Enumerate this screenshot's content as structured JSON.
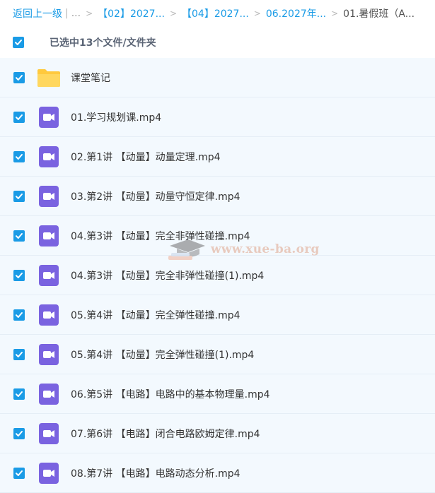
{
  "breadcrumb": {
    "back": "返回上一级",
    "separator": "|",
    "ellipsis": "...",
    "crumbs": [
      "【02】2027...",
      "【04】2027...",
      "06.2027年..."
    ],
    "current": "01.暑假班（A..."
  },
  "selection": {
    "text": "已选中13个文件/文件夹"
  },
  "files": [
    {
      "name": "课堂笔记",
      "type": "folder",
      "checked": true
    },
    {
      "name": "01.学习规划课.mp4",
      "type": "video",
      "checked": true
    },
    {
      "name": "02.第1讲 【动量】动量定理.mp4",
      "type": "video",
      "checked": true
    },
    {
      "name": "03.第2讲 【动量】动量守恒定律.mp4",
      "type": "video",
      "checked": true
    },
    {
      "name": "04.第3讲 【动量】完全非弹性碰撞.mp4",
      "type": "video",
      "checked": true
    },
    {
      "name": "04.第3讲 【动量】完全非弹性碰撞(1).mp4",
      "type": "video",
      "checked": true
    },
    {
      "name": "05.第4讲 【动量】完全弹性碰撞.mp4",
      "type": "video",
      "checked": true
    },
    {
      "name": "05.第4讲 【动量】完全弹性碰撞(1).mp4",
      "type": "video",
      "checked": true
    },
    {
      "name": "06.第5讲 【电路】电路中的基本物理量.mp4",
      "type": "video",
      "checked": true
    },
    {
      "name": "07.第6讲 【电路】闭合电路欧姆定律.mp4",
      "type": "video",
      "checked": true
    },
    {
      "name": "08.第7讲 【电路】电路动态分析.mp4",
      "type": "video",
      "checked": true
    }
  ],
  "watermark": {
    "text": "www.xue-ba.org"
  },
  "colors": {
    "accent": "#1a9be6",
    "video_icon": "#7a63e0",
    "folder": "#ffc93d",
    "row_bg": "#f3f9fe"
  },
  "icons": {
    "checkbox": "checkmark-icon",
    "folder": "folder-icon",
    "video": "video-file-icon"
  }
}
